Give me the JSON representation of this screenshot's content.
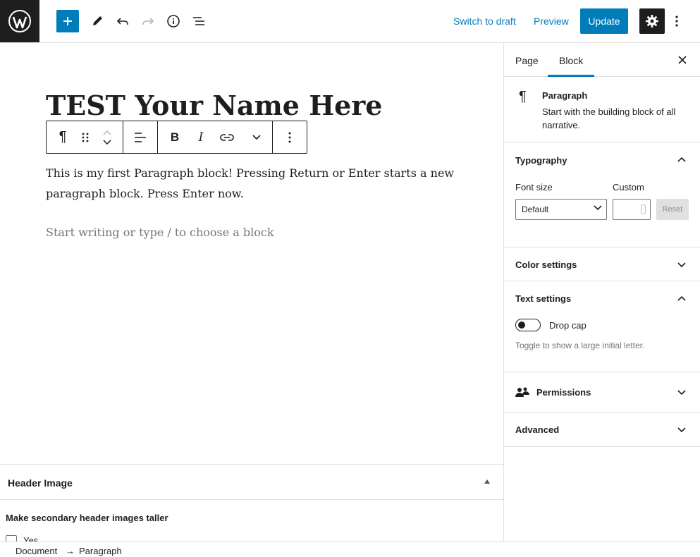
{
  "topbar": {
    "wp_logo": "wordpress-logo",
    "add_block": "plus-icon",
    "tools": "pencil-icon",
    "undo": "undo-icon",
    "redo": "redo-icon",
    "details": "info-icon",
    "list_view": "list-view-icon",
    "switch_to_draft": "Switch to draft",
    "preview": "Preview",
    "update": "Update",
    "settings": "gear-icon",
    "more": "more-vertical-icon"
  },
  "editor": {
    "title": "TEST Your Name Here",
    "paragraph": "This is my first Paragraph block! Pressing Return or Enter starts a new paragraph block. Press Enter now.",
    "placeholder": "Start writing or type / to choose a block",
    "toolbar": [
      "paragraph-icon",
      "drag-handle-icon",
      "move-up-down-icon",
      "align-left-icon",
      "bold-icon",
      "italic-icon",
      "link-icon",
      "chevron-down-icon",
      "more-vertical-icon"
    ]
  },
  "metabox": {
    "title": "Header Image",
    "label": "Make secondary header images taller",
    "option": "Yes"
  },
  "breadcrumb": {
    "root": "Document",
    "current": "Paragraph"
  },
  "sidebar": {
    "tabs": [
      "Page",
      "Block"
    ],
    "active_tab": "Block",
    "block_card": {
      "title": "Paragraph",
      "description": "Start with the building block of all narrative."
    },
    "typography": {
      "title": "Typography",
      "font_size_label": "Font size",
      "custom_label": "Custom",
      "font_size_value": "Default",
      "reset": "Reset"
    },
    "color_settings": "Color settings",
    "text_settings": {
      "title": "Text settings",
      "drop_cap": "Drop cap",
      "drop_cap_on": false,
      "help": "Toggle to show a large initial letter."
    },
    "permissions": "Permissions",
    "advanced": "Advanced"
  },
  "colors": {
    "accent": "#007cba",
    "dark": "#1e1e1e",
    "border": "#e0e0e0",
    "muted": "#757575"
  }
}
